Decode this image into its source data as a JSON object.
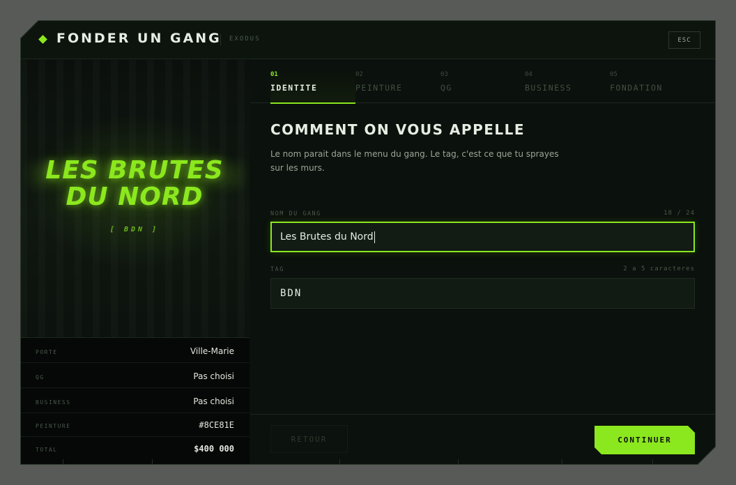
{
  "header": {
    "title": "FONDER UN GANG",
    "subtitle": "EXODUS",
    "esc_label": "ESC"
  },
  "preview": {
    "gang_name": "LES BRUTES DU NORD",
    "tag_display": "[ BDN ]",
    "accent_color": "#8ce81e"
  },
  "summary": {
    "rows": [
      {
        "key": "PORTE",
        "value": "Ville-Marie"
      },
      {
        "key": "QG",
        "value": "Pas choisi"
      },
      {
        "key": "BUSINESS",
        "value": "Pas choisi"
      },
      {
        "key": "PEINTURE",
        "value": "#8CE81E"
      },
      {
        "key": "TOTAL",
        "value": "$400 000"
      }
    ]
  },
  "tabs": [
    {
      "num": "01",
      "label": "IDENTITE",
      "active": true
    },
    {
      "num": "02",
      "label": "PEINTURE",
      "active": false
    },
    {
      "num": "03",
      "label": "QG",
      "active": false
    },
    {
      "num": "04",
      "label": "BUSINESS",
      "active": false
    },
    {
      "num": "05",
      "label": "FONDATION",
      "active": false
    }
  ],
  "form": {
    "heading": "COMMENT ON VOUS APPELLE",
    "description": "Le nom parait dans le menu du gang. Le tag, c'est ce que tu sprayes sur les murs.",
    "name_field": {
      "label": "NOM DU GANG",
      "counter": "18 / 24",
      "value": "Les Brutes du Nord"
    },
    "tag_field": {
      "label": "TAG",
      "hint": "2 a 5 caracteres",
      "value": "BDN"
    }
  },
  "footer": {
    "back_label": "RETOUR",
    "continue_label": "CONTINUER"
  }
}
